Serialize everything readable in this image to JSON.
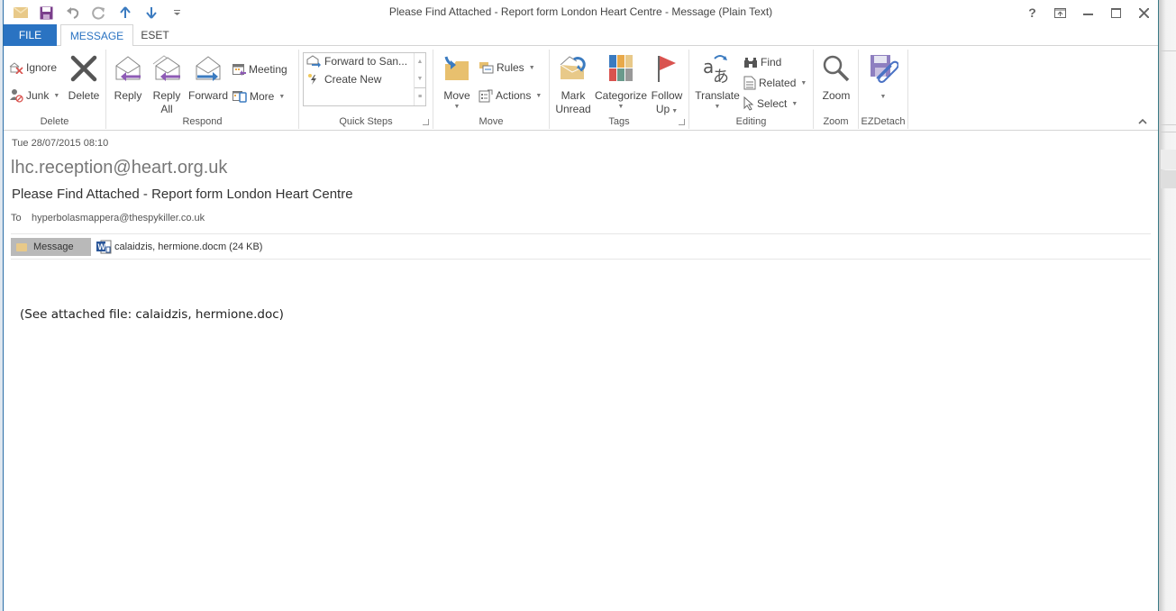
{
  "window": {
    "title": "Please Find Attached - Report form London Heart Centre - Message (Plain Text)",
    "controls": {
      "help": "?",
      "ribbon_options": "ribbon-display-options",
      "minimize": "minimize",
      "maximize": "maximize",
      "close": "close"
    }
  },
  "quick_access": [
    "mail-icon",
    "save-icon",
    "undo-icon",
    "redo-icon",
    "previous-item-icon",
    "next-item-icon",
    "customize-icon"
  ],
  "tabs": [
    {
      "label": "FILE",
      "active": false
    },
    {
      "label": "MESSAGE",
      "active": true
    },
    {
      "label": "ESET",
      "active": false
    }
  ],
  "ribbon": {
    "delete_group": {
      "label": "Delete",
      "ignore": "Ignore",
      "junk": "Junk",
      "delete": "Delete"
    },
    "respond_group": {
      "label": "Respond",
      "reply": "Reply",
      "reply_all_1": "Reply",
      "reply_all_2": "All",
      "forward": "Forward",
      "meeting": "Meeting",
      "more": "More"
    },
    "quick_steps_group": {
      "label": "Quick Steps",
      "items": [
        "Forward to San...",
        "Create New"
      ]
    },
    "move_group": {
      "label": "Move",
      "move": "Move",
      "rules": "Rules",
      "actions": "Actions"
    },
    "tags_group": {
      "label": "Tags",
      "mark_unread_1": "Mark",
      "mark_unread_2": "Unread",
      "categorize": "Categorize",
      "follow_up_1": "Follow",
      "follow_up_2": "Up"
    },
    "editing_group": {
      "label": "Editing",
      "translate": "Translate",
      "find": "Find",
      "related": "Related",
      "select": "Select"
    },
    "zoom_group": {
      "label": "Zoom",
      "zoom": "Zoom"
    },
    "ezdetach_group": {
      "label": "EZDetach"
    }
  },
  "message": {
    "date": "Tue 28/07/2015 08:10",
    "from": "lhc.reception@heart.org.uk",
    "subject": "Please Find Attached - Report form London Heart Centre",
    "to_label": "To",
    "to": "hyperbolasmappera@thespykiller.co.uk",
    "message_tab": "Message",
    "attachment": "calaidzis, hermione.docm (24 KB)",
    "body": "(See attached file: calaidzis, hermione.doc)"
  },
  "colors": {
    "accent": "#2a73c2",
    "reply_arrow": "#8e5bb5",
    "forward_arrow": "#3b7bc0",
    "flag": "#d9534f"
  }
}
